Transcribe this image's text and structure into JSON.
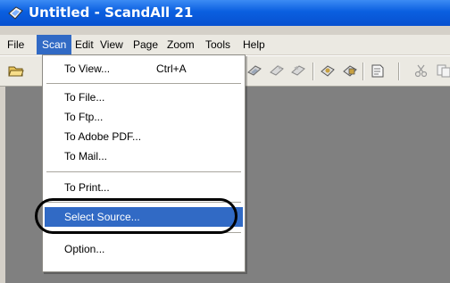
{
  "window": {
    "title": "Untitled - ScandAll 21"
  },
  "menubar": {
    "items": [
      "File",
      "Scan",
      "Edit",
      "View",
      "Page",
      "Zoom",
      "Tools",
      "Help"
    ],
    "active": "Scan"
  },
  "scan_menu": {
    "items": [
      {
        "label": "To View...",
        "shortcut": "Ctrl+A"
      },
      {
        "label": "To File..."
      },
      {
        "label": "To Ftp..."
      },
      {
        "label": "To Adobe PDF..."
      },
      {
        "label": "To Mail..."
      },
      {
        "label": "To Print..."
      },
      {
        "label": "Select Source...",
        "selected": true
      },
      {
        "label": "Option..."
      }
    ]
  },
  "colors": {
    "titlebar": "#0a5fe0",
    "selection": "#316ac5",
    "menu_bg": "#ebe9e2"
  },
  "icons": [
    "app-icon",
    "open-folder-icon",
    "scan-icon",
    "scan-next-icon",
    "scan-prev-icon",
    "source-icon",
    "settings-icon",
    "document-icon",
    "cut-icon",
    "copy-icon"
  ]
}
